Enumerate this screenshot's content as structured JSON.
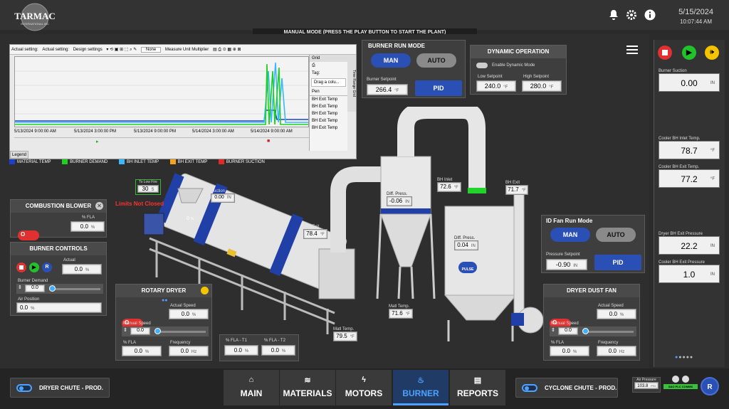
{
  "header": {
    "logo_text": "TARMAC",
    "logo_sub": "INTERNATIONAL INC",
    "date": "5/15/2024",
    "time": "10:07:44 AM",
    "banner": "MANUAL MODE (PRESS THE PLAY BUTTON TO START THE PLANT)"
  },
  "trend": {
    "toolbar": [
      "Actual setting:",
      "Actual setting:",
      "Design settings",
      "None",
      "Measure Unit Multiplier"
    ],
    "x_ticks": [
      "5/13/2024 9:00:00 AM",
      "5/13/2024 3:00:00 PM",
      "5/13/2024 9:00:00 PM",
      "5/14/2024 3:00:00 AM",
      "5/14/2024 9:00:00 AM"
    ],
    "grid_title": "Grid",
    "grid_tag": "Tag:",
    "grid_drag": "Drag a colu...",
    "grid_col": "Pen",
    "grid_rows": [
      "BH Exit Temp",
      "BH Exit Temp",
      "BH Exit Temp",
      "BH Exit Temp",
      "BH Exit Temp"
    ],
    "side_tabs": "Time Range   Grid",
    "legend_tab": "Legend",
    "legend": [
      {
        "label": "MATERIAL TEMP",
        "color": "#1c3fd0"
      },
      {
        "label": "BURNER DEMAND",
        "color": "#1fd11f"
      },
      {
        "label": "BH INLET TEMP",
        "color": "#39b7ff"
      },
      {
        "label": "BH EXIT TEMP",
        "color": "#f4a51c"
      },
      {
        "label": "BURNER SUCTION",
        "color": "#e02a2a"
      }
    ]
  },
  "burner_run": {
    "title": "BURNER RUN MODE",
    "man": "MAN",
    "auto": "AUTO",
    "setpoint_label": "Burner Setpoint",
    "setpoint": "266.4",
    "setpoint_unit": "°F",
    "pid": "PID"
  },
  "dynamic": {
    "title": "DYNAMIC OPERATION",
    "enable": "Enable Dynamic Mode",
    "low_label": "Low Setpoint",
    "low": "240.0",
    "high_label": "High Setpoint",
    "high": "280.0",
    "unit": "°F"
  },
  "process": {
    "to_low_fire_label": "To Low Fire",
    "to_low_fire": "30",
    "to_low_fire_unit": "S",
    "limits": "Limits Not Closed",
    "suction_label": "Suction",
    "suction": "0.00",
    "suction_unit": "IN",
    "dry_exit_label": "Dry. Exit",
    "dry_exit": "78.4",
    "cyc_diff_label": "Diff. Press.",
    "cyc_diff": "-0.06",
    "bh_inlet_label": "BH Inlet",
    "bh_inlet": "72.6",
    "bh_exit_label": "BH Exit",
    "bh_exit": "71.7",
    "bh_diff_label": "Diff. Press.",
    "bh_diff": "0.04",
    "pulse": "PULSE",
    "matl1_label": "Matl Temp.",
    "matl1": "71.6",
    "matl2_label": "Matl Temp.",
    "matl2": "79.5",
    "dryer_pct": "0",
    "dryer_pct_unit": "%",
    "unit_f": "°F",
    "unit_in": "IN"
  },
  "combustion_blower": {
    "title": "COMBUSTION BLOWER",
    "fla_label": "% FLA",
    "fla": "0.0",
    "unit": "%"
  },
  "burner_controls": {
    "title": "BURNER CONTROLS",
    "actual_label": "Actual",
    "actual": "0.0",
    "demand_label": "Burner Demand",
    "demand": "0.0",
    "air_label": "Air Position",
    "air": "0.0",
    "unit": "%",
    "r": "R"
  },
  "rotary_dryer": {
    "title": "ROTARY DRYER",
    "actual_label": "Actual Speed",
    "actual": "0.0",
    "manual_label": "Manual Speed",
    "manual": "0.0",
    "fla_label": "% FLA",
    "fla": "0.0",
    "freq_label": "Frequency",
    "freq": "0.0",
    "unit": "%",
    "hz": "Hz"
  },
  "fla_t": {
    "t1_label": "% FLA - T1",
    "t1": "0.0",
    "t2_label": "% FLA - T2",
    "t2": "0.0",
    "unit": "%"
  },
  "id_fan": {
    "title": "ID Fan Run Mode",
    "man": "MAN",
    "auto": "AUTO",
    "setpoint_label": "Pressure Setpoint",
    "setpoint": "-0.90",
    "unit": "IN",
    "pid": "PID"
  },
  "dust_fan": {
    "title": "DRYER DUST FAN",
    "actual_label": "Actual Speed",
    "actual": "0.0",
    "manual_label": "Manual Speed",
    "manual": "0.0",
    "fla_label": "% FLA",
    "fla": "0.0",
    "freq_label": "Frequency",
    "freq": "0.0",
    "unit": "%",
    "hz": "Hz"
  },
  "right": {
    "items": [
      {
        "label": "Burner Suction",
        "value": "0.00",
        "unit": "IN"
      },
      {
        "label": "Cooler BH Inlet Temp.",
        "value": "78.7",
        "unit": "°F"
      },
      {
        "label": "Cooler BH Exit Temp.",
        "value": "77.2",
        "unit": "°F"
      },
      {
        "label": "Dryer BH Exit Pressure",
        "value": "22.2",
        "unit": "IN"
      },
      {
        "label": "Cooler BH Exit Pressure",
        "value": "1.0",
        "unit": "IN"
      }
    ]
  },
  "footer": {
    "chute_left": "DRYER CHUTE - PROD.",
    "chute_right": "CYCLONE CHUTE - PROD.",
    "tabs": [
      "MAIN",
      "MATERIALS",
      "MOTORS",
      "BURNER",
      "REPORTS"
    ],
    "air_label": "Air Pressure",
    "air": "103.8",
    "air_unit": "PSI",
    "plc": "S&O PLC COMMS",
    "r": "R"
  },
  "colors": {
    "accent": "#2a4fb5",
    "active_tab": "#4ea2ff",
    "red": "#e03030",
    "green": "#22c32a",
    "yellow": "#f4c400"
  }
}
